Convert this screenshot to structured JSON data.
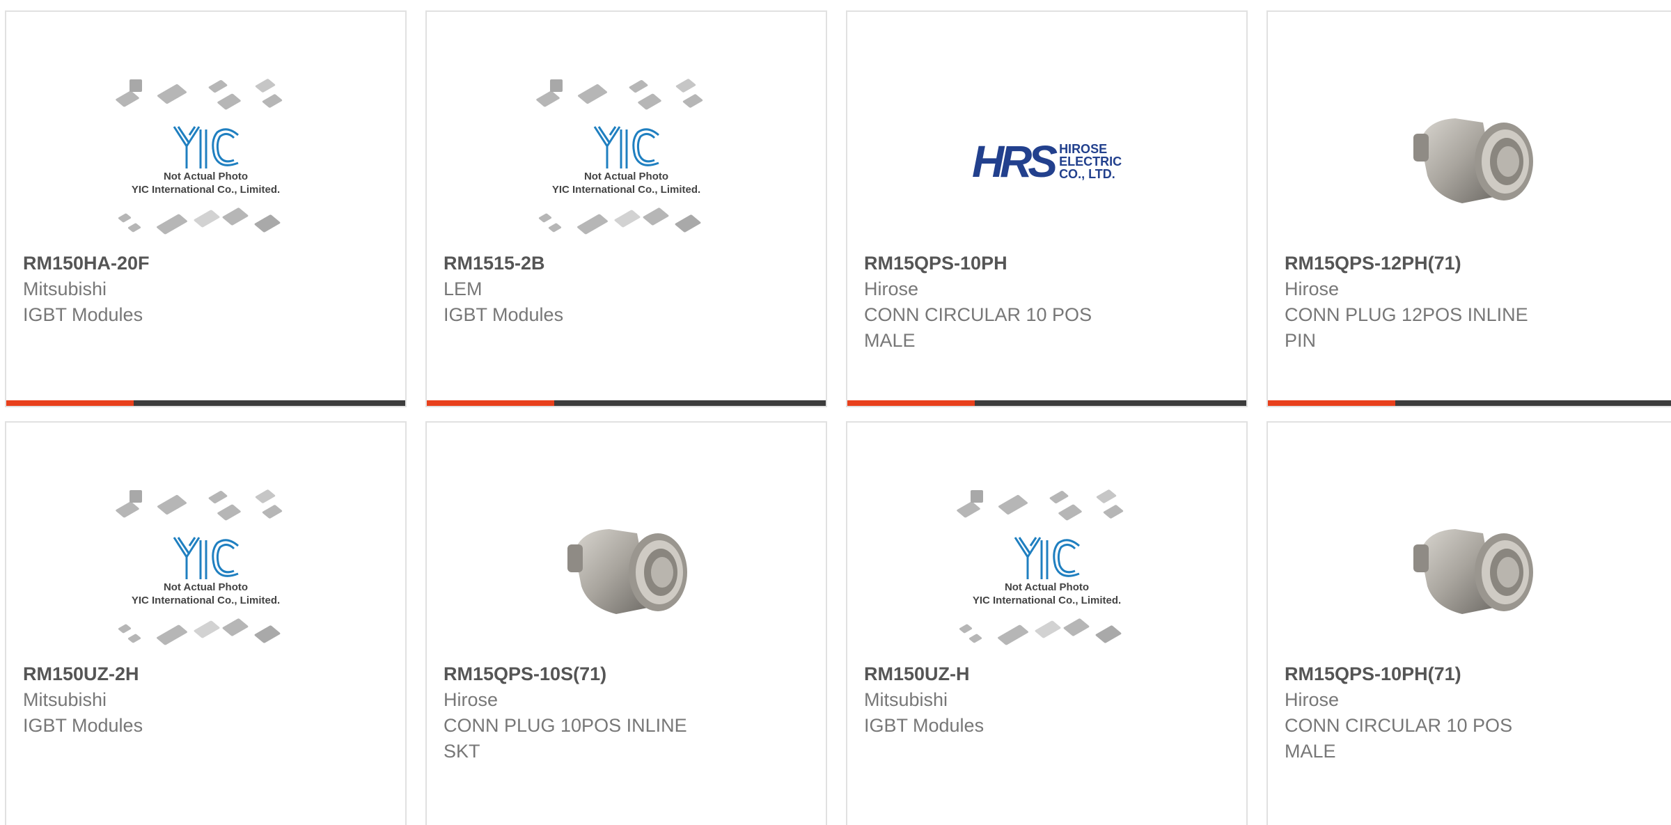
{
  "placeholder": {
    "line1": "Not Actual Photo",
    "line2": "YIC International Co., Limited."
  },
  "hirose_logo": {
    "mark": "HRS",
    "line1": "HIROSE",
    "line2": "ELECTRIC",
    "line3": "CO., LTD."
  },
  "colors": {
    "accent": "#e8401c",
    "bar": "#3c3c3c",
    "border": "#e1e1e1"
  },
  "products": [
    {
      "part": "RM150HA-20F",
      "manufacturer": "Mitsubishi",
      "description": "IGBT Modules",
      "image": "yic-placeholder"
    },
    {
      "part": "RM1515-2B",
      "manufacturer": "LEM",
      "description": "IGBT Modules",
      "image": "yic-placeholder"
    },
    {
      "part": "RM15QPS-10PH",
      "manufacturer": "Hirose",
      "description": "CONN CIRCULAR 10 POS MALE",
      "image": "hirose-logo"
    },
    {
      "part": "RM15QPS-12PH(71)",
      "manufacturer": "Hirose",
      "description": "CONN PLUG 12POS INLINE PIN",
      "image": "connector-photo"
    },
    {
      "part": "RM150UZ-2H",
      "manufacturer": "Mitsubishi",
      "description": "IGBT Modules",
      "image": "yic-placeholder"
    },
    {
      "part": "RM15QPS-10S(71)",
      "manufacturer": "Hirose",
      "description": "CONN PLUG 10POS INLINE SKT",
      "image": "connector-photo"
    },
    {
      "part": "RM150UZ-H",
      "manufacturer": "Mitsubishi",
      "description": "IGBT Modules",
      "image": "yic-placeholder"
    },
    {
      "part": "RM15QPS-10PH(71)",
      "manufacturer": "Hirose",
      "description": "CONN CIRCULAR 10 POS MALE",
      "image": "connector-photo"
    }
  ]
}
